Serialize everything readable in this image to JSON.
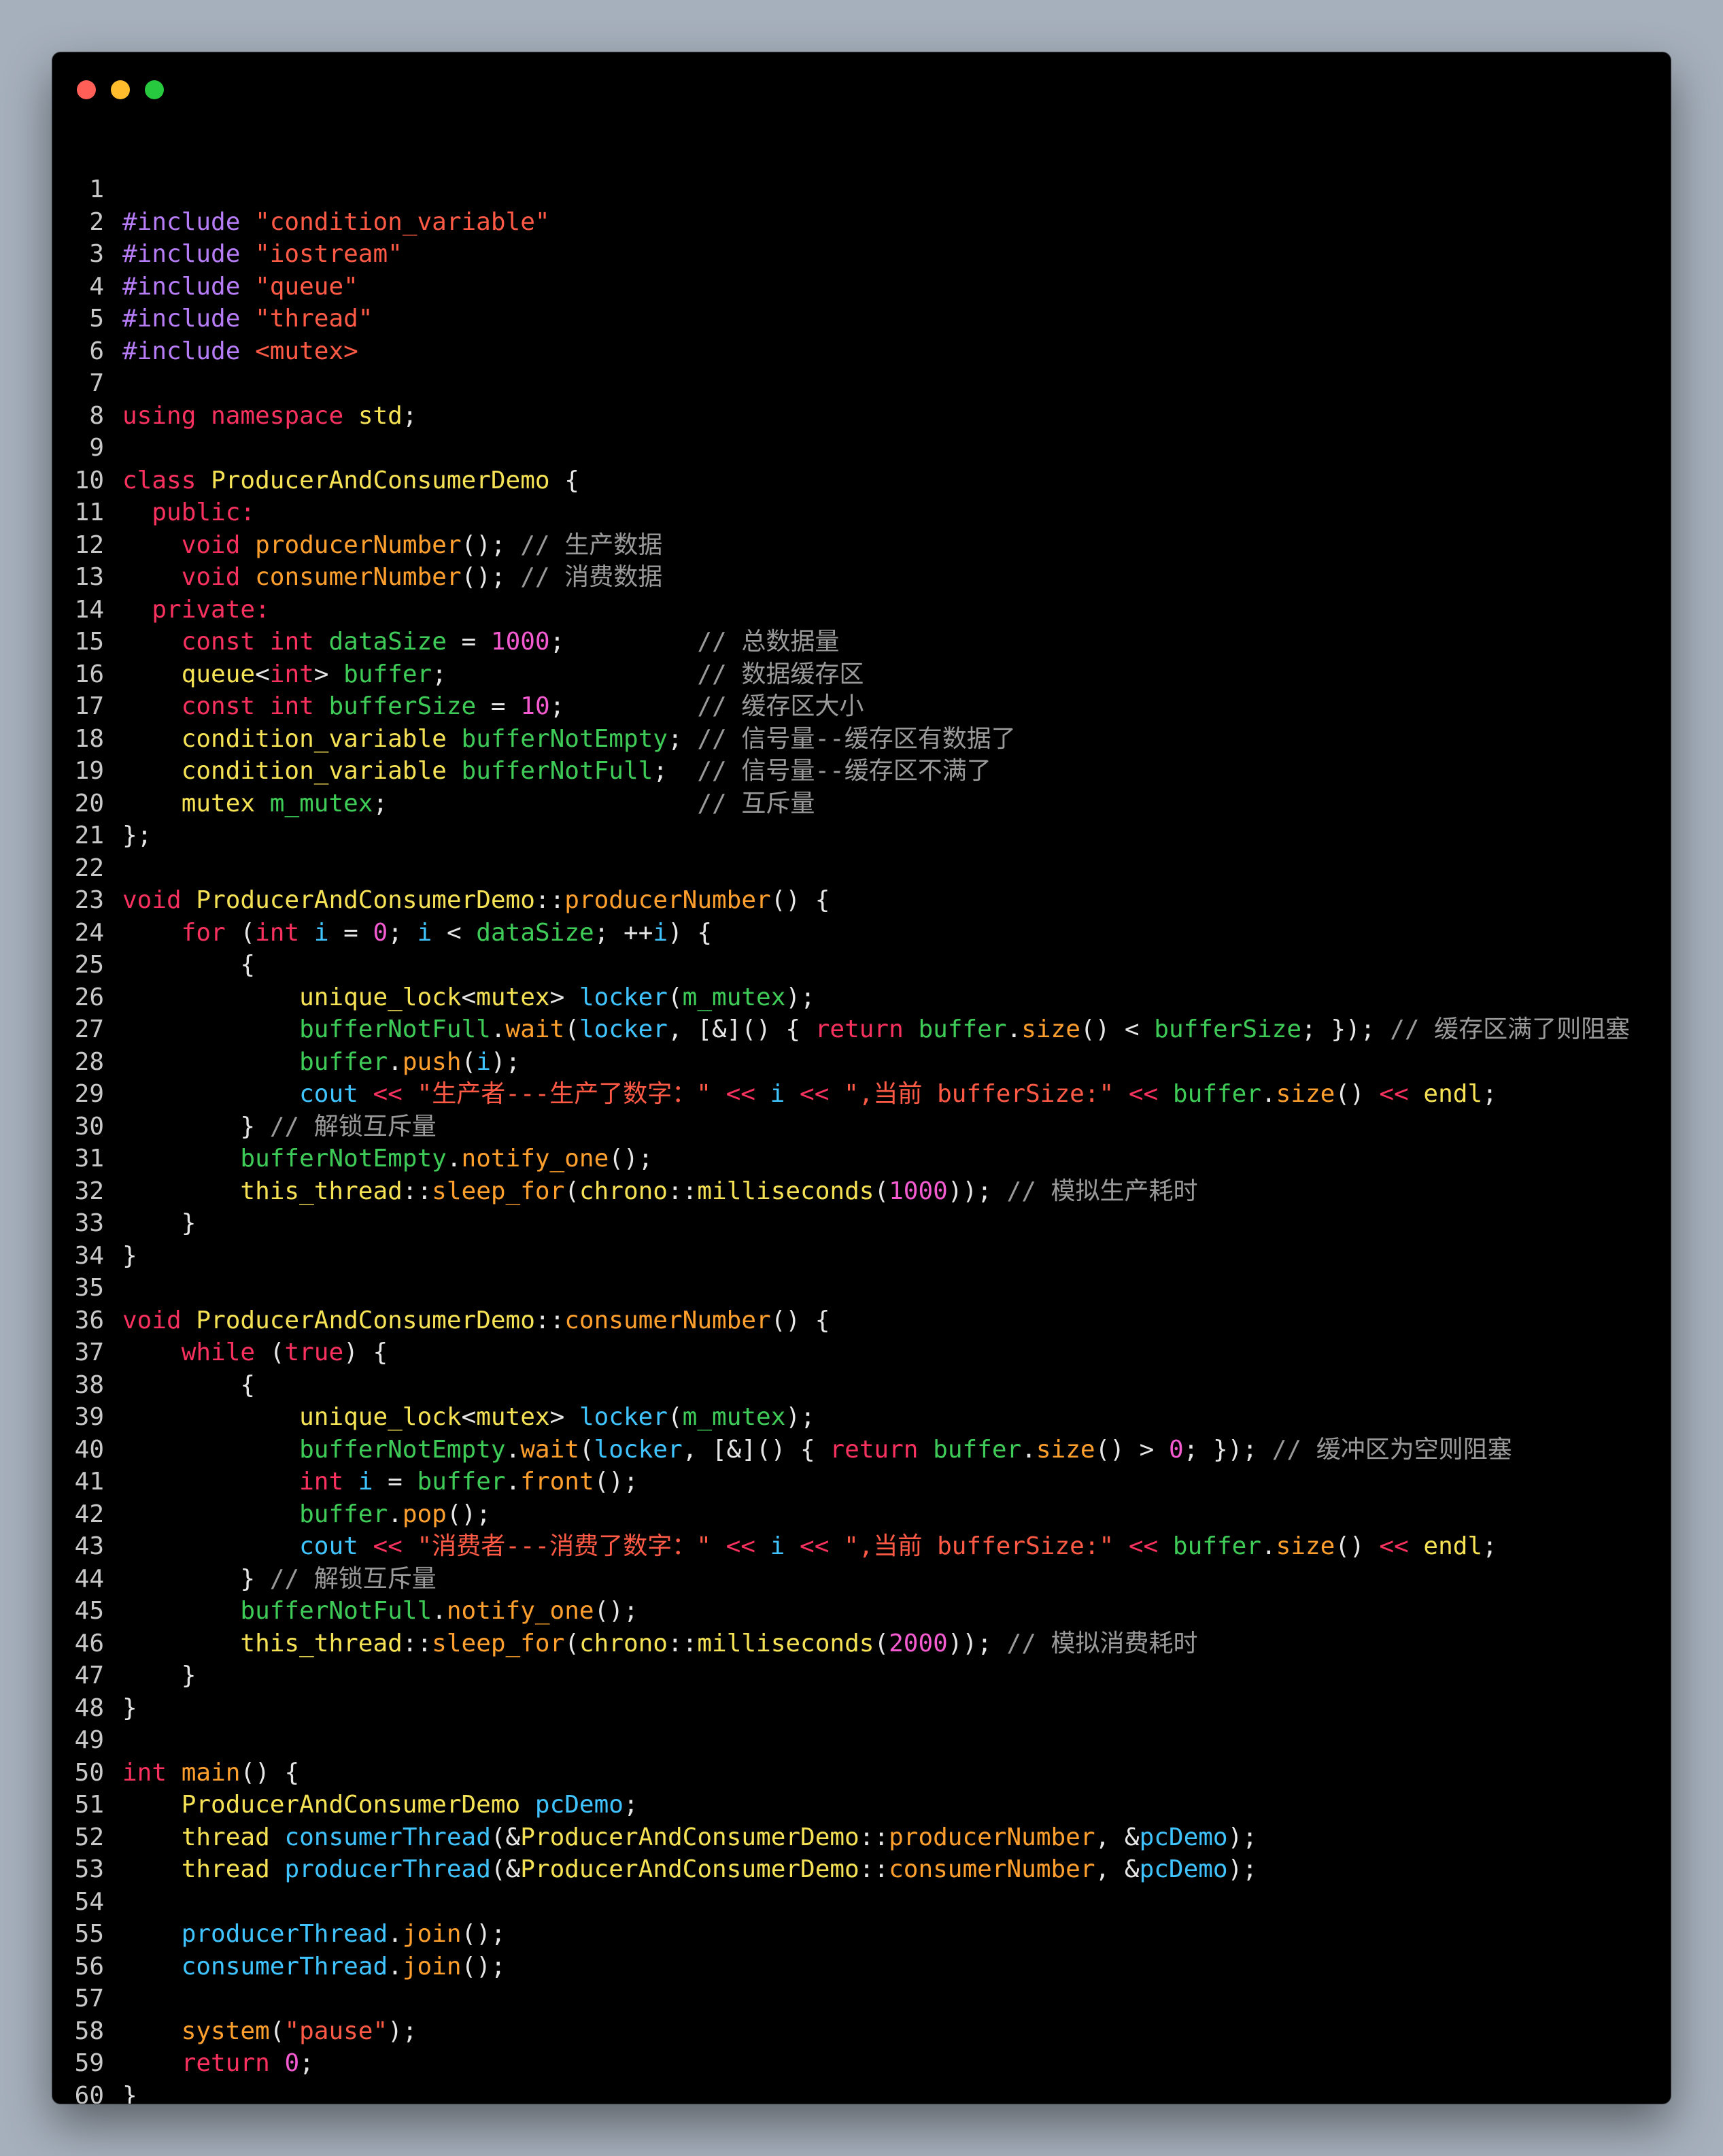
{
  "window": {
    "controls": [
      "close",
      "minimize",
      "zoom"
    ]
  },
  "colors": {
    "keyword": "#f8315f",
    "preprocessor": "#b77cf7",
    "string": "#ff5a45",
    "type": "#f6e255",
    "function": "#ff9f2d",
    "variable": "#40c4ff",
    "member": "#3ecb57",
    "number": "#f45bd0",
    "comment": "#9a9a9a",
    "plain": "#e6e6e6"
  },
  "code_lines": [
    [],
    [
      [
        "pp",
        "#include"
      ],
      [
        "pl",
        " "
      ],
      [
        "str",
        "\"condition_variable\""
      ]
    ],
    [
      [
        "pp",
        "#include"
      ],
      [
        "pl",
        " "
      ],
      [
        "str",
        "\"iostream\""
      ]
    ],
    [
      [
        "pp",
        "#include"
      ],
      [
        "pl",
        " "
      ],
      [
        "str",
        "\"queue\""
      ]
    ],
    [
      [
        "pp",
        "#include"
      ],
      [
        "pl",
        " "
      ],
      [
        "str",
        "\"thread\""
      ]
    ],
    [
      [
        "pp",
        "#include"
      ],
      [
        "pl",
        " "
      ],
      [
        "str",
        "<mutex>"
      ]
    ],
    [],
    [
      [
        "kw",
        "using"
      ],
      [
        "pl",
        " "
      ],
      [
        "kw",
        "namespace"
      ],
      [
        "pl",
        " "
      ],
      [
        "ty",
        "std"
      ],
      [
        "pl",
        ";"
      ]
    ],
    [],
    [
      [
        "kw",
        "class"
      ],
      [
        "pl",
        " "
      ],
      [
        "ty",
        "ProducerAndConsumerDemo"
      ],
      [
        "pl",
        " {"
      ]
    ],
    [
      [
        "pl",
        "  "
      ],
      [
        "kw",
        "public:"
      ]
    ],
    [
      [
        "pl",
        "    "
      ],
      [
        "kw",
        "void"
      ],
      [
        "pl",
        " "
      ],
      [
        "fn",
        "producerNumber"
      ],
      [
        "pl",
        "(); "
      ],
      [
        "cm",
        "// 生产数据"
      ]
    ],
    [
      [
        "pl",
        "    "
      ],
      [
        "kw",
        "void"
      ],
      [
        "pl",
        " "
      ],
      [
        "fn",
        "consumerNumber"
      ],
      [
        "pl",
        "(); "
      ],
      [
        "cm",
        "// 消费数据"
      ]
    ],
    [
      [
        "pl",
        "  "
      ],
      [
        "kw",
        "private:"
      ]
    ],
    [
      [
        "pl",
        "    "
      ],
      [
        "kw",
        "const"
      ],
      [
        "pl",
        " "
      ],
      [
        "kw",
        "int"
      ],
      [
        "pl",
        " "
      ],
      [
        "mem",
        "dataSize"
      ],
      [
        "pl",
        " = "
      ],
      [
        "num",
        "1000"
      ],
      [
        "pl",
        ";         "
      ],
      [
        "cm",
        "// 总数据量"
      ]
    ],
    [
      [
        "pl",
        "    "
      ],
      [
        "ty",
        "queue"
      ],
      [
        "pl",
        "<"
      ],
      [
        "kw",
        "int"
      ],
      [
        "pl",
        "> "
      ],
      [
        "mem",
        "buffer"
      ],
      [
        "pl",
        ";                 "
      ],
      [
        "cm",
        "// 数据缓存区"
      ]
    ],
    [
      [
        "pl",
        "    "
      ],
      [
        "kw",
        "const"
      ],
      [
        "pl",
        " "
      ],
      [
        "kw",
        "int"
      ],
      [
        "pl",
        " "
      ],
      [
        "mem",
        "bufferSize"
      ],
      [
        "pl",
        " = "
      ],
      [
        "num",
        "10"
      ],
      [
        "pl",
        ";         "
      ],
      [
        "cm",
        "// 缓存区大小"
      ]
    ],
    [
      [
        "pl",
        "    "
      ],
      [
        "ty",
        "condition_variable"
      ],
      [
        "pl",
        " "
      ],
      [
        "mem",
        "bufferNotEmpty"
      ],
      [
        "pl",
        "; "
      ],
      [
        "cm",
        "// 信号量--缓存区有数据了"
      ]
    ],
    [
      [
        "pl",
        "    "
      ],
      [
        "ty",
        "condition_variable"
      ],
      [
        "pl",
        " "
      ],
      [
        "mem",
        "bufferNotFull"
      ],
      [
        "pl",
        ";  "
      ],
      [
        "cm",
        "// 信号量--缓存区不满了"
      ]
    ],
    [
      [
        "pl",
        "    "
      ],
      [
        "ty",
        "mutex"
      ],
      [
        "pl",
        " "
      ],
      [
        "mem",
        "m_mutex"
      ],
      [
        "pl",
        ";                     "
      ],
      [
        "cm",
        "// 互斥量"
      ]
    ],
    [
      [
        "pl",
        "};"
      ]
    ],
    [],
    [
      [
        "kw",
        "void"
      ],
      [
        "pl",
        " "
      ],
      [
        "ty",
        "ProducerAndConsumerDemo"
      ],
      [
        "pl",
        "::"
      ],
      [
        "fn",
        "producerNumber"
      ],
      [
        "pl",
        "() {"
      ]
    ],
    [
      [
        "pl",
        "    "
      ],
      [
        "kw",
        "for"
      ],
      [
        "pl",
        " ("
      ],
      [
        "kw",
        "int"
      ],
      [
        "pl",
        " "
      ],
      [
        "var",
        "i"
      ],
      [
        "pl",
        " = "
      ],
      [
        "num",
        "0"
      ],
      [
        "pl",
        "; "
      ],
      [
        "var",
        "i"
      ],
      [
        "pl",
        " < "
      ],
      [
        "mem",
        "dataSize"
      ],
      [
        "pl",
        "; ++"
      ],
      [
        "var",
        "i"
      ],
      [
        "pl",
        ") {"
      ]
    ],
    [
      [
        "pl",
        "        {"
      ]
    ],
    [
      [
        "pl",
        "            "
      ],
      [
        "ty",
        "unique_lock"
      ],
      [
        "pl",
        "<"
      ],
      [
        "ty",
        "mutex"
      ],
      [
        "pl",
        "> "
      ],
      [
        "var",
        "locker"
      ],
      [
        "pl",
        "("
      ],
      [
        "mem",
        "m_mutex"
      ],
      [
        "pl",
        ");"
      ]
    ],
    [
      [
        "pl",
        "            "
      ],
      [
        "mem",
        "bufferNotFull"
      ],
      [
        "pl",
        "."
      ],
      [
        "fn",
        "wait"
      ],
      [
        "pl",
        "("
      ],
      [
        "var",
        "locker"
      ],
      [
        "pl",
        ", [&]() { "
      ],
      [
        "kw",
        "return"
      ],
      [
        "pl",
        " "
      ],
      [
        "mem",
        "buffer"
      ],
      [
        "pl",
        "."
      ],
      [
        "fn",
        "size"
      ],
      [
        "pl",
        "() < "
      ],
      [
        "mem",
        "bufferSize"
      ],
      [
        "pl",
        "; }); "
      ],
      [
        "cm",
        "// 缓存区满了则阻塞"
      ]
    ],
    [
      [
        "pl",
        "            "
      ],
      [
        "mem",
        "buffer"
      ],
      [
        "pl",
        "."
      ],
      [
        "fn",
        "push"
      ],
      [
        "pl",
        "("
      ],
      [
        "var",
        "i"
      ],
      [
        "pl",
        ");"
      ]
    ],
    [
      [
        "pl",
        "            "
      ],
      [
        "var",
        "cout"
      ],
      [
        "pl",
        " "
      ],
      [
        "kw",
        "<<"
      ],
      [
        "pl",
        " "
      ],
      [
        "str",
        "\"生产者---生产了数字：\""
      ],
      [
        "pl",
        " "
      ],
      [
        "kw",
        "<<"
      ],
      [
        "pl",
        " "
      ],
      [
        "var",
        "i"
      ],
      [
        "pl",
        " "
      ],
      [
        "kw",
        "<<"
      ],
      [
        "pl",
        " "
      ],
      [
        "str",
        "\",当前 bufferSize:\""
      ],
      [
        "pl",
        " "
      ],
      [
        "kw",
        "<<"
      ],
      [
        "pl",
        " "
      ],
      [
        "mem",
        "buffer"
      ],
      [
        "pl",
        "."
      ],
      [
        "fn",
        "size"
      ],
      [
        "pl",
        "() "
      ],
      [
        "kw",
        "<<"
      ],
      [
        "pl",
        " "
      ],
      [
        "ty",
        "endl"
      ],
      [
        "pl",
        ";"
      ]
    ],
    [
      [
        "pl",
        "        } "
      ],
      [
        "cm",
        "// 解锁互斥量"
      ]
    ],
    [
      [
        "pl",
        "        "
      ],
      [
        "mem",
        "bufferNotEmpty"
      ],
      [
        "pl",
        "."
      ],
      [
        "fn",
        "notify_one"
      ],
      [
        "pl",
        "();"
      ]
    ],
    [
      [
        "pl",
        "        "
      ],
      [
        "ty",
        "this_thread"
      ],
      [
        "pl",
        "::"
      ],
      [
        "fn",
        "sleep_for"
      ],
      [
        "pl",
        "("
      ],
      [
        "ty",
        "chrono"
      ],
      [
        "pl",
        "::"
      ],
      [
        "ty",
        "milliseconds"
      ],
      [
        "pl",
        "("
      ],
      [
        "num",
        "1000"
      ],
      [
        "pl",
        ")); "
      ],
      [
        "cm",
        "// 模拟生产耗时"
      ]
    ],
    [
      [
        "pl",
        "    }"
      ]
    ],
    [
      [
        "pl",
        "}"
      ]
    ],
    [],
    [
      [
        "kw",
        "void"
      ],
      [
        "pl",
        " "
      ],
      [
        "ty",
        "ProducerAndConsumerDemo"
      ],
      [
        "pl",
        "::"
      ],
      [
        "fn",
        "consumerNumber"
      ],
      [
        "pl",
        "() {"
      ]
    ],
    [
      [
        "pl",
        "    "
      ],
      [
        "kw",
        "while"
      ],
      [
        "pl",
        " ("
      ],
      [
        "kw",
        "true"
      ],
      [
        "pl",
        ") {"
      ]
    ],
    [
      [
        "pl",
        "        {"
      ]
    ],
    [
      [
        "pl",
        "            "
      ],
      [
        "ty",
        "unique_lock"
      ],
      [
        "pl",
        "<"
      ],
      [
        "ty",
        "mutex"
      ],
      [
        "pl",
        "> "
      ],
      [
        "var",
        "locker"
      ],
      [
        "pl",
        "("
      ],
      [
        "mem",
        "m_mutex"
      ],
      [
        "pl",
        ");"
      ]
    ],
    [
      [
        "pl",
        "            "
      ],
      [
        "mem",
        "bufferNotEmpty"
      ],
      [
        "pl",
        "."
      ],
      [
        "fn",
        "wait"
      ],
      [
        "pl",
        "("
      ],
      [
        "var",
        "locker"
      ],
      [
        "pl",
        ", [&]() { "
      ],
      [
        "kw",
        "return"
      ],
      [
        "pl",
        " "
      ],
      [
        "mem",
        "buffer"
      ],
      [
        "pl",
        "."
      ],
      [
        "fn",
        "size"
      ],
      [
        "pl",
        "() > "
      ],
      [
        "num",
        "0"
      ],
      [
        "pl",
        "; }); "
      ],
      [
        "cm",
        "// 缓冲区为空则阻塞"
      ]
    ],
    [
      [
        "pl",
        "            "
      ],
      [
        "kw",
        "int"
      ],
      [
        "pl",
        " "
      ],
      [
        "var",
        "i"
      ],
      [
        "pl",
        " = "
      ],
      [
        "mem",
        "buffer"
      ],
      [
        "pl",
        "."
      ],
      [
        "fn",
        "front"
      ],
      [
        "pl",
        "();"
      ]
    ],
    [
      [
        "pl",
        "            "
      ],
      [
        "mem",
        "buffer"
      ],
      [
        "pl",
        "."
      ],
      [
        "fn",
        "pop"
      ],
      [
        "pl",
        "();"
      ]
    ],
    [
      [
        "pl",
        "            "
      ],
      [
        "var",
        "cout"
      ],
      [
        "pl",
        " "
      ],
      [
        "kw",
        "<<"
      ],
      [
        "pl",
        " "
      ],
      [
        "str",
        "\"消费者---消费了数字：\""
      ],
      [
        "pl",
        " "
      ],
      [
        "kw",
        "<<"
      ],
      [
        "pl",
        " "
      ],
      [
        "var",
        "i"
      ],
      [
        "pl",
        " "
      ],
      [
        "kw",
        "<<"
      ],
      [
        "pl",
        " "
      ],
      [
        "str",
        "\",当前 bufferSize:\""
      ],
      [
        "pl",
        " "
      ],
      [
        "kw",
        "<<"
      ],
      [
        "pl",
        " "
      ],
      [
        "mem",
        "buffer"
      ],
      [
        "pl",
        "."
      ],
      [
        "fn",
        "size"
      ],
      [
        "pl",
        "() "
      ],
      [
        "kw",
        "<<"
      ],
      [
        "pl",
        " "
      ],
      [
        "ty",
        "endl"
      ],
      [
        "pl",
        ";"
      ]
    ],
    [
      [
        "pl",
        "        } "
      ],
      [
        "cm",
        "// 解锁互斥量"
      ]
    ],
    [
      [
        "pl",
        "        "
      ],
      [
        "mem",
        "bufferNotFull"
      ],
      [
        "pl",
        "."
      ],
      [
        "fn",
        "notify_one"
      ],
      [
        "pl",
        "();"
      ]
    ],
    [
      [
        "pl",
        "        "
      ],
      [
        "ty",
        "this_thread"
      ],
      [
        "pl",
        "::"
      ],
      [
        "fn",
        "sleep_for"
      ],
      [
        "pl",
        "("
      ],
      [
        "ty",
        "chrono"
      ],
      [
        "pl",
        "::"
      ],
      [
        "ty",
        "milliseconds"
      ],
      [
        "pl",
        "("
      ],
      [
        "num",
        "2000"
      ],
      [
        "pl",
        ")); "
      ],
      [
        "cm",
        "// 模拟消费耗时"
      ]
    ],
    [
      [
        "pl",
        "    }"
      ]
    ],
    [
      [
        "pl",
        "}"
      ]
    ],
    [],
    [
      [
        "kw",
        "int"
      ],
      [
        "pl",
        " "
      ],
      [
        "fn",
        "main"
      ],
      [
        "pl",
        "() {"
      ]
    ],
    [
      [
        "pl",
        "    "
      ],
      [
        "ty",
        "ProducerAndConsumerDemo"
      ],
      [
        "pl",
        " "
      ],
      [
        "var",
        "pcDemo"
      ],
      [
        "pl",
        ";"
      ]
    ],
    [
      [
        "pl",
        "    "
      ],
      [
        "ty",
        "thread"
      ],
      [
        "pl",
        " "
      ],
      [
        "var",
        "consumerThread"
      ],
      [
        "pl",
        "(&"
      ],
      [
        "ty",
        "ProducerAndConsumerDemo"
      ],
      [
        "pl",
        "::"
      ],
      [
        "fn",
        "producerNumber"
      ],
      [
        "pl",
        ", &"
      ],
      [
        "var",
        "pcDemo"
      ],
      [
        "pl",
        ");"
      ]
    ],
    [
      [
        "pl",
        "    "
      ],
      [
        "ty",
        "thread"
      ],
      [
        "pl",
        " "
      ],
      [
        "var",
        "producerThread"
      ],
      [
        "pl",
        "(&"
      ],
      [
        "ty",
        "ProducerAndConsumerDemo"
      ],
      [
        "pl",
        "::"
      ],
      [
        "fn",
        "consumerNumber"
      ],
      [
        "pl",
        ", &"
      ],
      [
        "var",
        "pcDemo"
      ],
      [
        "pl",
        ");"
      ]
    ],
    [],
    [
      [
        "pl",
        "    "
      ],
      [
        "var",
        "producerThread"
      ],
      [
        "pl",
        "."
      ],
      [
        "fn",
        "join"
      ],
      [
        "pl",
        "();"
      ]
    ],
    [
      [
        "pl",
        "    "
      ],
      [
        "var",
        "consumerThread"
      ],
      [
        "pl",
        "."
      ],
      [
        "fn",
        "join"
      ],
      [
        "pl",
        "();"
      ]
    ],
    [],
    [
      [
        "pl",
        "    "
      ],
      [
        "fn",
        "system"
      ],
      [
        "pl",
        "("
      ],
      [
        "str",
        "\"pause\""
      ],
      [
        "pl",
        ");"
      ]
    ],
    [
      [
        "pl",
        "    "
      ],
      [
        "kw",
        "return"
      ],
      [
        "pl",
        " "
      ],
      [
        "num",
        "0"
      ],
      [
        "pl",
        ";"
      ]
    ],
    [
      [
        "pl",
        "}"
      ]
    ]
  ]
}
